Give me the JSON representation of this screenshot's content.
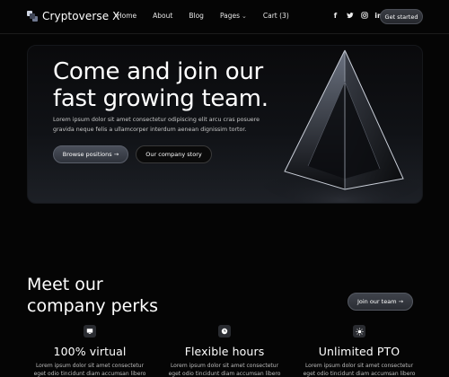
{
  "nav": {
    "brand": "Cryptoverse X",
    "links": [
      "Home",
      "About",
      "Blog",
      "Pages",
      "Cart (3)"
    ],
    "socials": [
      "f",
      "t",
      "ig",
      "in"
    ],
    "cta": "Get started"
  },
  "hero": {
    "title_line1": "Come and join our",
    "title_line2": "fast growing team.",
    "desc_line1": "Lorem ipsum dolor sit amet consectetur odipiscing elit arcu cras posuere",
    "desc_line2": "gravida neque felis a ullamcorper interdum aenean dignissim tortor.",
    "primary_button": "Browse positions →",
    "secondary_button": "Our company story"
  },
  "perks": {
    "title_line1": "Meet our",
    "title_line2": "company perks",
    "button": "Join our team →",
    "items": [
      {
        "title": "100% virtual",
        "desc_line1": "Lorem ipsum dolor sit amet consectetur",
        "desc_line2": "eget odio tincidunt diam accumsan libero",
        "icon": "monitor-icon"
      },
      {
        "title": "Flexible hours",
        "desc_line1": "Lorem ipsum dolor sit amet consectetur",
        "desc_line2": "eget odio tincidunt diam accumsan libero",
        "icon": "clock-icon"
      },
      {
        "title": "Unlimited PTO",
        "desc_line1": "Lorem ipsum dolor sit amet consectetur",
        "desc_line2": "eget odio tincidunt diam accumsan libero",
        "icon": "sun-icon"
      }
    ]
  },
  "colors": {
    "background": "#050505",
    "hero_gradient_bottom": "#1d2026",
    "button_grey": "#3f434b"
  }
}
